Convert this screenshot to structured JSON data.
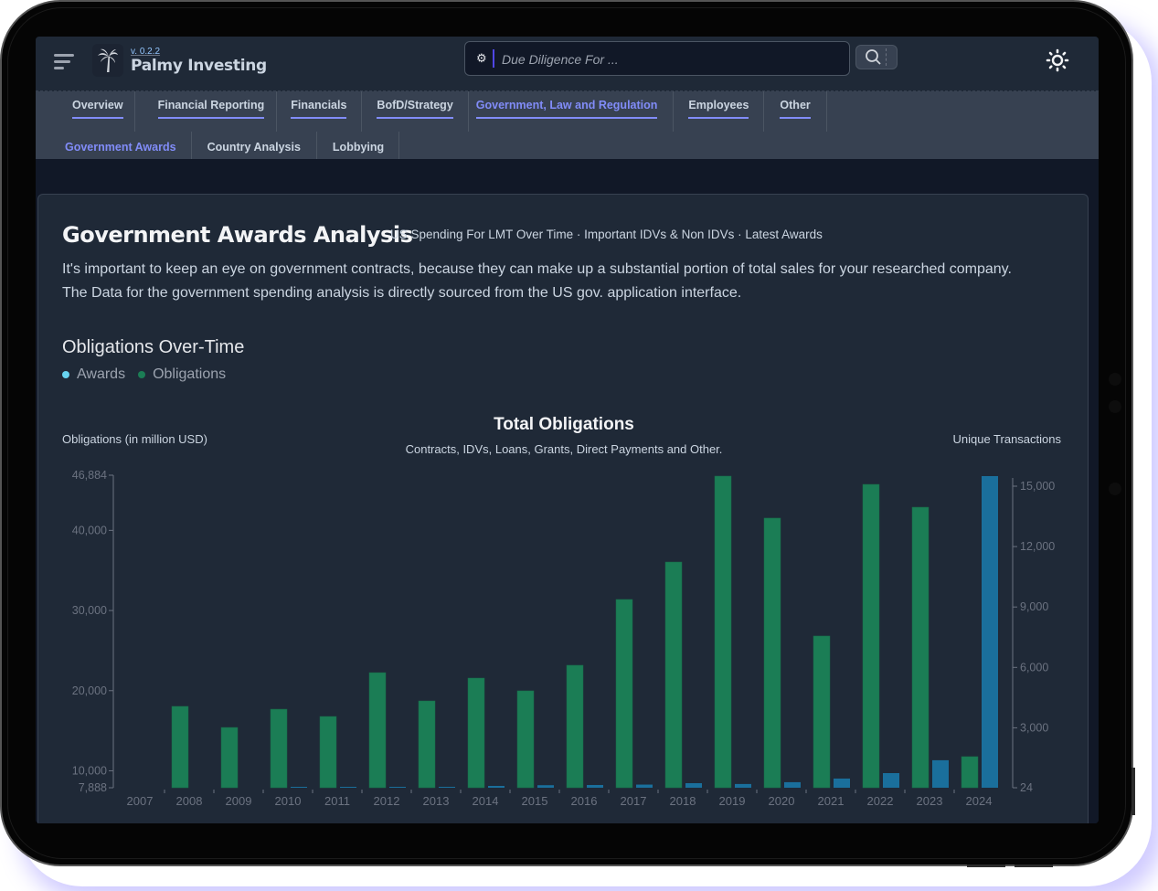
{
  "header": {
    "version": "v. 0.2.2",
    "brand": "Palmy Investing",
    "search_placeholder": "Due Diligence For ...",
    "icons": {
      "menu": "hamburger-icon",
      "logo": "palm-tree-icon",
      "search_settings": "gear-icon",
      "search": "magnifier-icon",
      "theme": "sun-icon"
    }
  },
  "nav": {
    "primary_tabs": [
      {
        "label": "Overview",
        "active": false
      },
      {
        "label": "Financial Reporting",
        "active": false
      },
      {
        "label": "Financials",
        "active": false
      },
      {
        "label": "BofD/Strategy",
        "active": false
      },
      {
        "label": "Government, Law and Regulation",
        "active": true
      },
      {
        "label": "Employees",
        "active": false
      },
      {
        "label": "Other",
        "active": false
      }
    ],
    "secondary_tabs": [
      {
        "label": "Government Awards",
        "active": true
      },
      {
        "label": "Country Analysis",
        "active": false
      },
      {
        "label": "Lobbying",
        "active": false
      }
    ]
  },
  "page": {
    "title": "Government Awards Analysis",
    "subtitle": "US Spending For LMT Over Time · Important IDVs & Non IDVs · Latest Awards",
    "description": "It's important to keep an eye on government contracts, because they can make up a substantial portion of total sales for your researched company. The Data for the government spending analysis is directly sourced from the US gov. application interface.",
    "section_title": "Obligations Over-Time",
    "legend": [
      {
        "label": "Awards",
        "color": "#67d3f0"
      },
      {
        "label": "Obligations",
        "color": "#1b7d55"
      }
    ]
  },
  "chart_data": {
    "type": "bar",
    "title": "Total Obligations",
    "subtitle": "Contracts, IDVs, Loans, Grants, Direct Payments and Other.",
    "ylabel": "Obligations (in million USD)",
    "y2label": "Unique Transactions",
    "categories": [
      "2007",
      "2008",
      "2009",
      "2010",
      "2011",
      "2012",
      "2013",
      "2014",
      "2015",
      "2016",
      "2017",
      "2018",
      "2019",
      "2020",
      "2021",
      "2022",
      "2023",
      "2024"
    ],
    "ylim": [
      7888,
      46884
    ],
    "y2lim": [
      24,
      15000
    ],
    "yticks": [
      "46,884",
      "40,000",
      "30,000",
      "20,000",
      "10,000",
      "7,888"
    ],
    "yticks_values": [
      46884,
      40000,
      30000,
      20000,
      10000,
      7888
    ],
    "y2ticks": [
      "15,000",
      "12,000",
      "9,000",
      "6,000",
      "3,000",
      "24"
    ],
    "y2ticks_values": [
      15000,
      12000,
      9000,
      6000,
      3000,
      24
    ],
    "grid": false,
    "series": [
      {
        "name": "Obligations",
        "axis": "left",
        "color": "#1b7d55",
        "values": [
          null,
          18040,
          15410,
          17690,
          16780,
          22250,
          18720,
          21570,
          19980,
          23170,
          31380,
          36050,
          46770,
          41530,
          26820,
          45740,
          42890,
          11770
        ]
      },
      {
        "name": "Unique Transactions",
        "axis": "right",
        "color": "#1a6f9c",
        "values": [
          null,
          null,
          null,
          45,
          50,
          60,
          70,
          115,
          150,
          160,
          180,
          250,
          210,
          300,
          480,
          750,
          1390,
          15500
        ]
      }
    ]
  }
}
